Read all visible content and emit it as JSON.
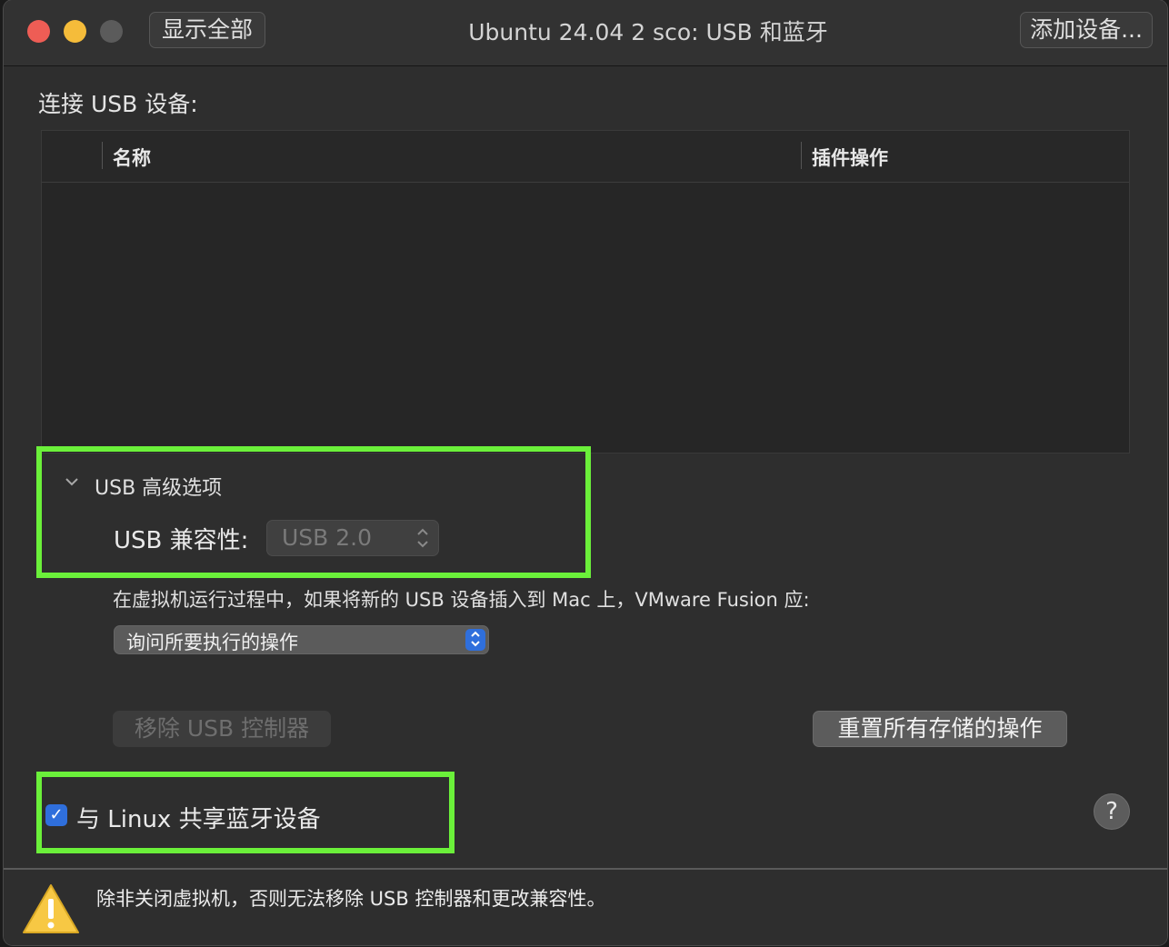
{
  "window": {
    "title": "Ubuntu 24.04 2 sco: USB 和蓝牙",
    "show_all_label": "显示全部",
    "add_device_label": "添加设备..."
  },
  "usb": {
    "section_label": "连接 USB 设备:",
    "table": {
      "columns": [
        "名称",
        "插件操作"
      ],
      "rows": []
    },
    "advanced": {
      "label": "USB 高级选项",
      "expanded": true,
      "compat_label": "USB 兼容性:",
      "compat_value": "USB 2.0",
      "compat_enabled": false
    },
    "new_device_prompt": "在虚拟机运行过程中，如果将新的 USB 设备插入到 Mac 上，VMware Fusion 应:",
    "new_device_action": "询问所要执行的操作",
    "remove_controller_label": "移除 USB 控制器",
    "reset_actions_label": "重置所有存储的操作"
  },
  "bluetooth": {
    "share_label": "与 Linux 共享蓝牙设备",
    "share_checked": true
  },
  "help_label": "?",
  "footer": {
    "warning_text": "除非关闭虚拟机，否则无法移除 USB 控制器和更改兼容性。",
    "icon": "warning-icon"
  },
  "colors": {
    "highlight": "#6bf03a",
    "accent": "#2f6fdc",
    "close": "#ee5d55",
    "minimize": "#f5bc3a"
  }
}
